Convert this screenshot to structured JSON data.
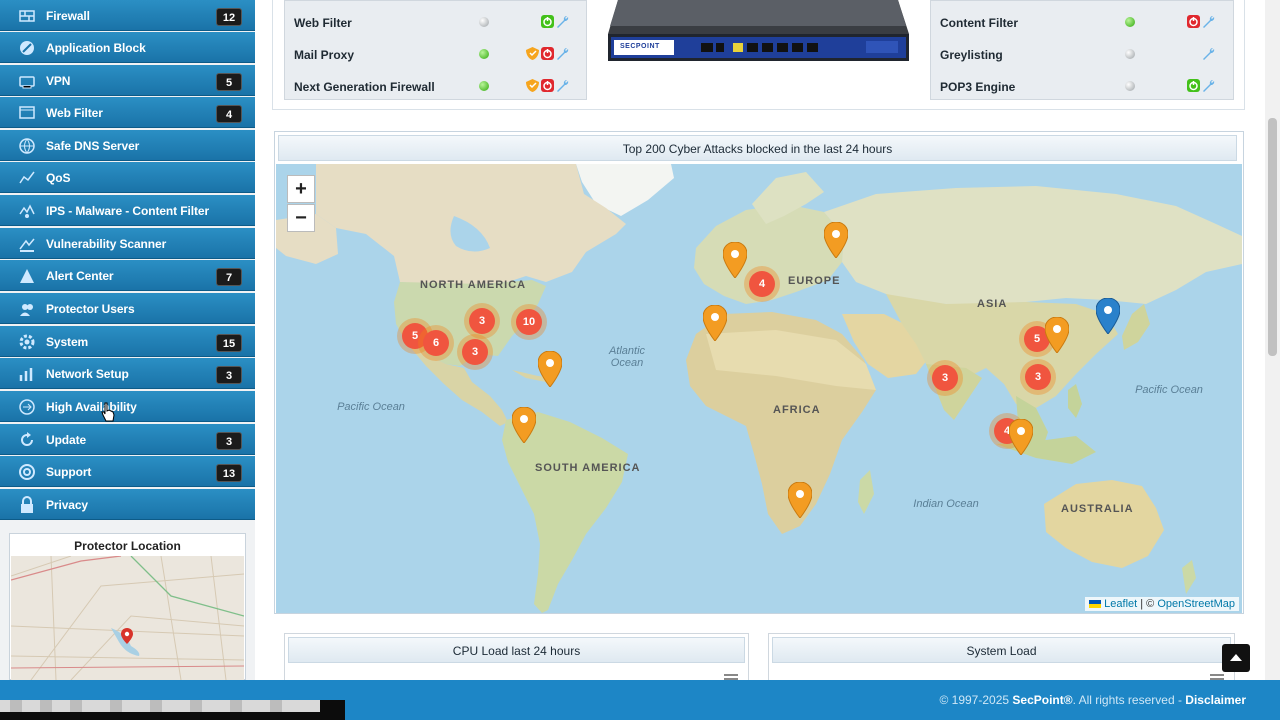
{
  "sidebar": {
    "items": [
      {
        "label": "Firewall",
        "badge": "12",
        "icon": "firewall-icon"
      },
      {
        "label": "Application Block",
        "badge": "",
        "icon": "app-block-icon"
      },
      {
        "label": "VPN",
        "badge": "5",
        "icon": "vpn-icon"
      },
      {
        "label": "Web Filter",
        "badge": "4",
        "icon": "web-filter-icon"
      },
      {
        "label": "Safe DNS Server",
        "badge": "",
        "icon": "dns-icon"
      },
      {
        "label": "QoS",
        "badge": "",
        "icon": "qos-icon"
      },
      {
        "label": "IPS - Malware - Content Filter",
        "badge": "",
        "icon": "ips-icon"
      },
      {
        "label": "Vulnerability Scanner",
        "badge": "",
        "icon": "scanner-icon"
      },
      {
        "label": "Alert Center",
        "badge": "7",
        "icon": "alert-icon"
      },
      {
        "label": "Protector Users",
        "badge": "",
        "icon": "users-icon"
      },
      {
        "label": "System",
        "badge": "15",
        "icon": "gear-icon"
      },
      {
        "label": "Network Setup",
        "badge": "3",
        "icon": "network-icon"
      },
      {
        "label": "High Availability",
        "badge": "",
        "icon": "ha-icon"
      },
      {
        "label": "Update",
        "badge": "3",
        "icon": "update-icon"
      },
      {
        "label": "Support",
        "badge": "13",
        "icon": "support-icon"
      },
      {
        "label": "Privacy",
        "badge": "",
        "icon": "lock-icon"
      }
    ],
    "location_title": "Protector Location"
  },
  "services_left": [
    {
      "name": "Web Filter",
      "status": "green-small",
      "actions": [
        "power-on-icon",
        "wrench-icon"
      ]
    },
    {
      "name": "Mail Proxy",
      "status": "green",
      "actions": [
        "shield-icon",
        "power-off-icon",
        "wrench-icon"
      ]
    },
    {
      "name": "Next Generation Firewall",
      "status": "green",
      "actions": [
        "shield-icon",
        "power-off-icon",
        "wrench-icon"
      ]
    }
  ],
  "services_right": [
    {
      "name": "Content Filter",
      "status": "green",
      "actions": [
        "power-off-icon",
        "wrench-icon"
      ]
    },
    {
      "name": "Greylisting",
      "status": "gray",
      "actions": [
        "wrench-icon"
      ]
    },
    {
      "name": "POP3 Engine",
      "status": "gray",
      "actions": [
        "power-on-icon",
        "wrench-icon"
      ]
    }
  ],
  "map": {
    "title": "Top 200 Cyber Attacks blocked in the last 24 hours",
    "zoom_in": "+",
    "zoom_out": "−",
    "attribution_leaflet": "Leaflet",
    "attribution_sep": " | © ",
    "attribution_osm": "OpenStreetMap",
    "continents": [
      "NORTH AMERICA",
      "EUROPE",
      "ASIA",
      "AFRICA",
      "SOUTH AMERICA",
      "AUSTRALIA"
    ],
    "oceans": [
      "Atlantic Ocean",
      "Pacific Ocean",
      "Pacific Ocean",
      "Indian Ocean"
    ],
    "clusters": [
      "5",
      "6",
      "3",
      "3",
      "10",
      "4",
      "3",
      "5",
      "3",
      "4"
    ]
  },
  "panels": {
    "cpu": "CPU Load last 24 hours",
    "system": "System Load"
  },
  "footer": {
    "prefix": "© 1997-2025 ",
    "brand": "SecPoint®",
    "suffix": ". All rights reserved - ",
    "disclaimer": "Disclaimer"
  },
  "device": {
    "brand": "SECPOINT"
  }
}
